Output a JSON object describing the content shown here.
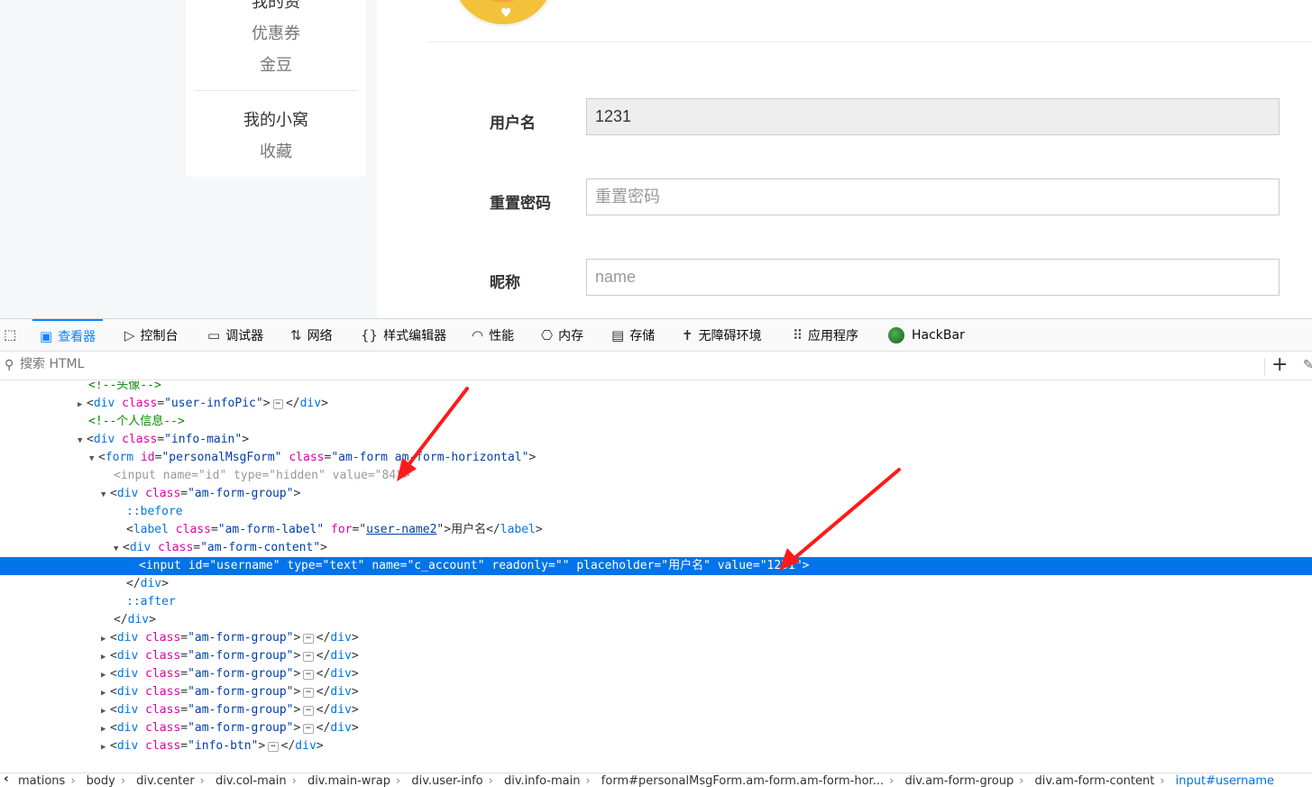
{
  "sidebar": {
    "links": [
      {
        "label": "我的资"
      },
      {
        "label": "优惠券"
      },
      {
        "label": "金豆"
      },
      {
        "label": "我的小窝"
      },
      {
        "label": "收藏"
      }
    ]
  },
  "form": {
    "username_label": "用户名",
    "username_value": "1231",
    "password_label": "重置密码",
    "password_placeholder": "重置密码",
    "nickname_label": "昵称",
    "nickname_placeholder": "name"
  },
  "devtools": {
    "tabs": [
      {
        "label": "查看器",
        "icon": "inspector-icon"
      },
      {
        "label": "控制台",
        "icon": "console-icon"
      },
      {
        "label": "调试器",
        "icon": "debugger-icon"
      },
      {
        "label": "网络",
        "icon": "network-icon"
      },
      {
        "label": "样式编辑器",
        "icon": "style-editor-icon"
      },
      {
        "label": "性能",
        "icon": "performance-icon"
      },
      {
        "label": "内存",
        "icon": "memory-icon"
      },
      {
        "label": "存储",
        "icon": "storage-icon"
      },
      {
        "label": "无障碍环境",
        "icon": "accessibility-icon"
      },
      {
        "label": "应用程序",
        "icon": "application-icon"
      },
      {
        "label": "HackBar",
        "icon": "hackbar-icon"
      }
    ],
    "search_placeholder": "搜索 HTML",
    "tree": {
      "comment_avatar": "<!--头像-->",
      "info_pic_class": "\"user-infoPic\"",
      "comment_info": "<!--个人信息-->",
      "info_main_class": "\"info-main\"",
      "form_id": "\"personalMsgForm\"",
      "form_class": "\"am-form am-form-horizontal\"",
      "hidden_name": "\"id\"",
      "hidden_type": "\"hidden\"",
      "hidden_value": "\"84\"",
      "group_class": "\"am-form-group\"",
      "before": "::before",
      "label_class": "\"am-form-label\"",
      "label_for": "user-name2",
      "label_text": "用户名",
      "content_class": "\"am-form-content\"",
      "input_id": "\"username\"",
      "input_type": "\"text\"",
      "input_name": "\"c_account\"",
      "input_readonly": "\"\"",
      "input_placeholder": "\"用户名\"",
      "input_value": "\"1231\"",
      "after": "::after",
      "info_btn_class": "\"info-btn\""
    },
    "breadcrumbs": [
      "mations",
      "body",
      "div.center",
      "div.col-main",
      "div.main-wrap",
      "div.user-info",
      "div.info-main",
      "form#personalMsgForm.am-form.am-form-hor...",
      "div.am-form-group",
      "div.am-form-content",
      "input#username"
    ]
  },
  "colors": {
    "accent": "#0074e8",
    "arrow": "#ff1a1a"
  }
}
